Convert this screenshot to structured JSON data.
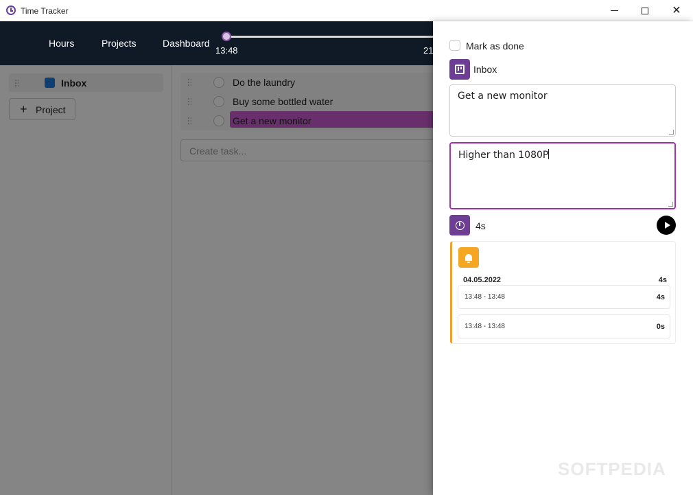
{
  "window": {
    "title": "Time Tracker",
    "controls": {
      "minimize": "minimize",
      "maximize": "maximize",
      "close": "✕"
    }
  },
  "topnav": {
    "items": [
      "Hours",
      "Projects",
      "Dashboard"
    ],
    "timeline_start": "13:48",
    "timeline_end_partial": "21"
  },
  "sidebar": {
    "projects": [
      {
        "name": "Inbox",
        "color": "#1e7ad6"
      }
    ],
    "add_project_label": "Project"
  },
  "tasks": {
    "items": [
      {
        "text": "Do the laundry",
        "selected": false
      },
      {
        "text": "Buy some bottled water",
        "selected": false
      },
      {
        "text": "Get a new monitor",
        "selected": true
      }
    ],
    "create_placeholder": "Create task..."
  },
  "detail": {
    "mark_done_label": "Mark as done",
    "project_label": "Inbox",
    "title_value": "Get a new monitor",
    "description_value": "Higher than 1080P",
    "time_total": "4s",
    "log": {
      "date": "04.05.2022",
      "date_total": "4s",
      "entries": [
        {
          "range": "13:48 - 13:48",
          "duration": "4s"
        },
        {
          "range": "13:48 - 13:48",
          "duration": "0s"
        }
      ]
    }
  },
  "watermark": "SOFTPEDIA",
  "colors": {
    "accent": "#6e3d94",
    "nav_bg": "#0f1a26",
    "highlight": "#c85bd0",
    "log_accent": "#f2a12b"
  }
}
